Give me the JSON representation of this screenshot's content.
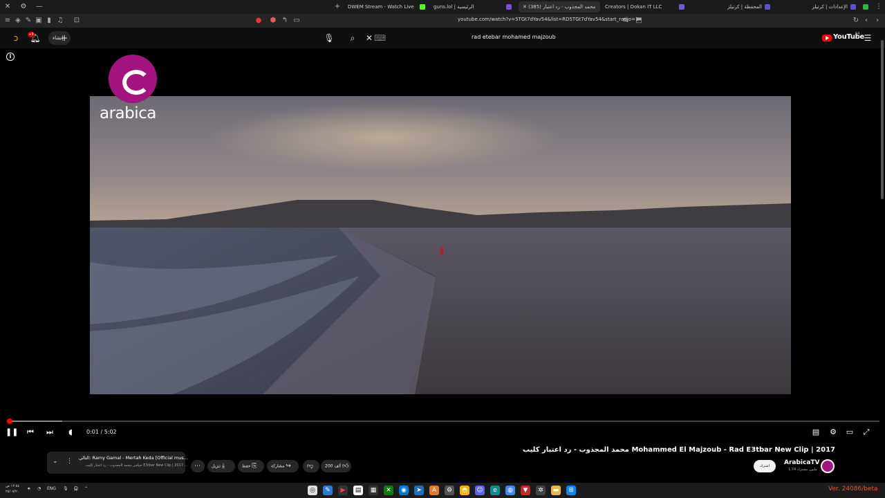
{
  "browser": {
    "tabs": [
      {
        "label": "DWEM Stream - Watch Live on Kick",
        "active": false
      },
      {
        "label": "guns.lol | الرئيسية",
        "active": false
      },
      {
        "label": "(385) محمد المجذوب - رد اعتبار",
        "active": true
      },
      {
        "label": "Creators | Dokan IT LLC",
        "active": false
      },
      {
        "label": "المحفظة | كرتيلز",
        "active": false
      },
      {
        "label": "الإعدادات | كرتيلز",
        "active": false
      }
    ],
    "url": "youtube.com/watch?v=5TGt7dYav54&list=RD5TGt7dYav54&start_radio=1"
  },
  "youtube": {
    "create_label": "إنشاء",
    "notification_count": "+9",
    "search_query": "rad etebar mohamed majzoub",
    "logo_text": "YouTube",
    "region": "SA"
  },
  "player": {
    "watermark_text": "arabica",
    "current_time": "0:01 / 5:02",
    "progress_fraction": 0.0033,
    "buffer_fraction": 0.063
  },
  "video": {
    "title": "محمد المجذوب - رد اعتبار كليب Mohammed El Majzoub - Rad E3tbar New Clip | 2017",
    "channel_name": "ArabicaTV",
    "subscribers": "1.74 مليون مشترك",
    "subscribe_label": "اشترك",
    "like_count": "200 ألف",
    "share_label": "مشاركة",
    "save_label": "حفظ",
    "download_label": "تنزيل"
  },
  "mini_queue": {
    "next_title": "التالي: Ramy Gamal - Mertah Keda [Official mus...",
    "subtitle": "جيكس محمد المجذوب - رد اعتبار كليب E3tbar New Clip | 2017 ..."
  },
  "taskbar": {
    "time": "١٢:٥٤ ص",
    "date": "٢٥/٠٧/٢٠",
    "lang": "ENG",
    "version": "Ver. 24086/beta"
  }
}
